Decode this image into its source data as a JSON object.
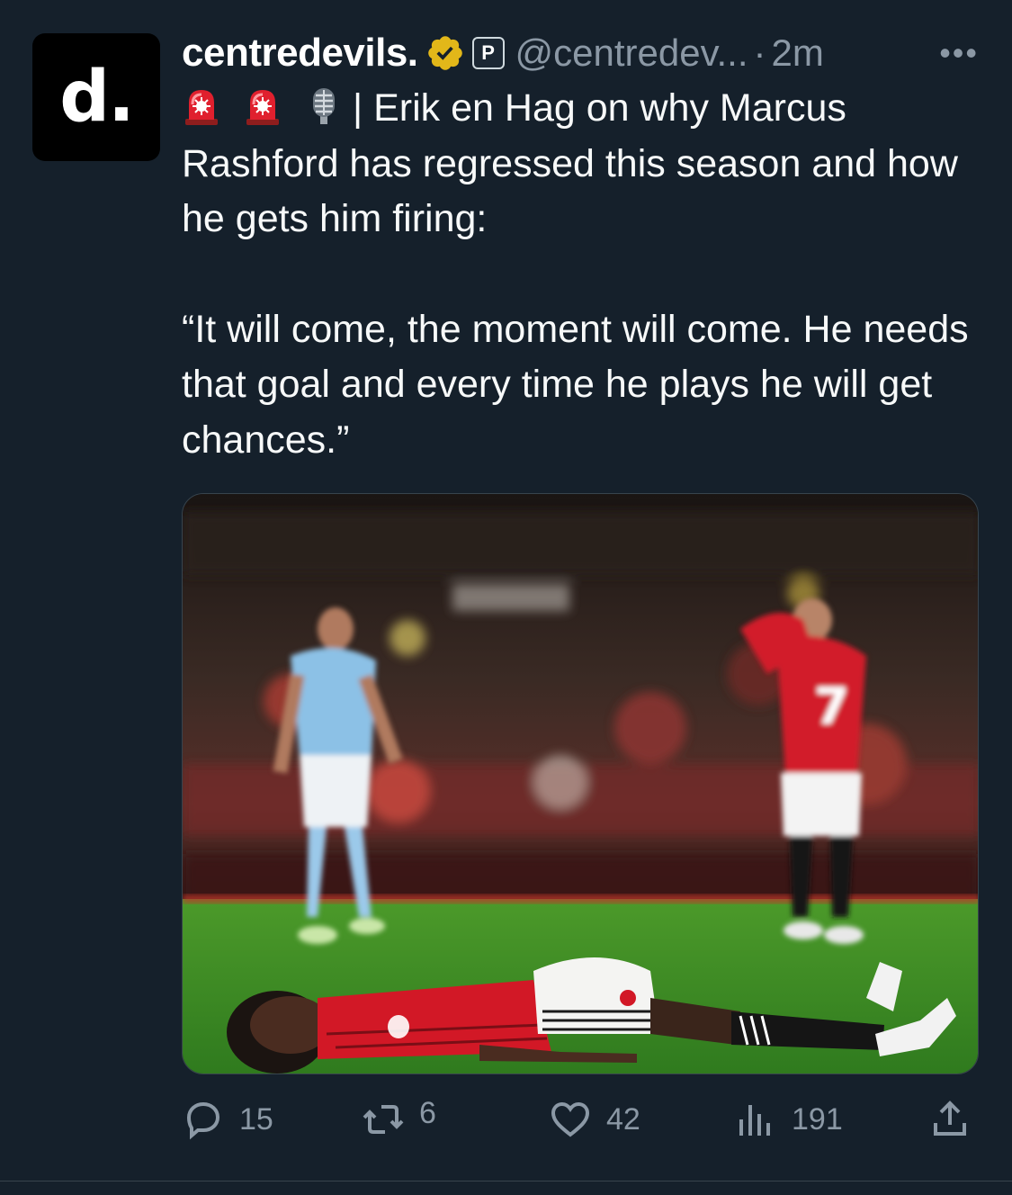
{
  "tweet": {
    "avatar_letter": "d.",
    "display_name": "centredevils.",
    "handle": "@centredev...",
    "separator": "·",
    "time": "2m",
    "more": "•••",
    "affiliate_badge_letter": "P",
    "emojis": [
      "police-light-emoji",
      "police-light-emoji",
      "microphone-emoji"
    ],
    "text_line1": "| Erik en Hag on why Marcus Rashford has regressed this season and how he gets him firing:",
    "text_para2": "“It will come, the moment will come. He needs that goal and every time he plays he will get chances.”",
    "media_icon": "football-photo",
    "actions": {
      "replies": "15",
      "retweets": "6",
      "likes": "42",
      "views": "191"
    },
    "colors": {
      "background": "#15202b",
      "secondary_text": "#8b98a5",
      "verified_gold": "#e2b719",
      "pitch_green": "#3e8f2a",
      "united_red": "#c8102e"
    }
  }
}
